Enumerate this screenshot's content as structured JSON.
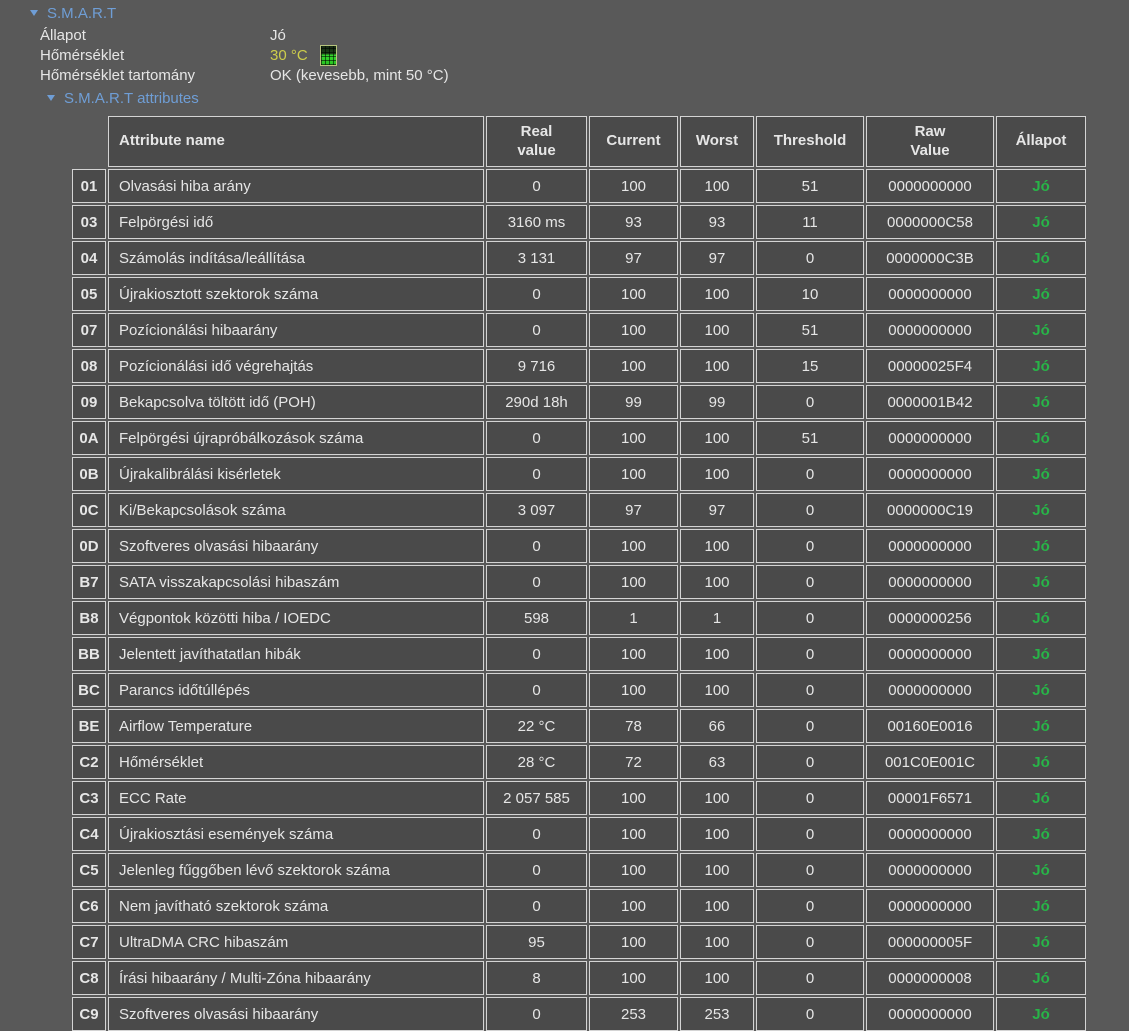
{
  "colors": {
    "page_bg": "#595959",
    "cell_bg": "#4a4a4a",
    "cell_border": "#d4d4d4",
    "section_blue": "#6f9ed6",
    "temperature_yellow": "#cdcd4b",
    "status_green": "#28b448",
    "text": "#e6e6e6"
  },
  "section": {
    "title": "S.M.A.R.T",
    "info": [
      {
        "label": "Állapot",
        "value": "Jó"
      },
      {
        "label": "Hőmérséklet",
        "value": "30 °C",
        "icon": "temperature-gauge-icon"
      },
      {
        "label": "Hőmérséklet tartomány",
        "value": "OK (kevesebb, mint 50 °C)"
      }
    ],
    "subsection_title": "S.M.A.R.T attributes"
  },
  "table": {
    "headers": [
      {
        "label": "Attribute name"
      },
      {
        "label": "Real\nvalue"
      },
      {
        "label": "Current"
      },
      {
        "label": "Worst"
      },
      {
        "label": "Threshold"
      },
      {
        "label": "Raw\nValue"
      },
      {
        "label": "Állapot"
      }
    ],
    "rows": [
      {
        "id": "01",
        "name": "Olvasási hiba arány",
        "real": "0",
        "current": "100",
        "worst": "100",
        "threshold": "51",
        "raw": "0000000000",
        "status": "Jó"
      },
      {
        "id": "03",
        "name": "Felpörgési idő",
        "real": "3160 ms",
        "current": "93",
        "worst": "93",
        "threshold": "11",
        "raw": "0000000C58",
        "status": "Jó"
      },
      {
        "id": "04",
        "name": "Számolás indítása/leállítása",
        "real": "3 131",
        "current": "97",
        "worst": "97",
        "threshold": "0",
        "raw": "0000000C3B",
        "status": "Jó"
      },
      {
        "id": "05",
        "name": "Újrakiosztott szektorok száma",
        "real": "0",
        "current": "100",
        "worst": "100",
        "threshold": "10",
        "raw": "0000000000",
        "status": "Jó"
      },
      {
        "id": "07",
        "name": "Pozícionálási hibaarány",
        "real": "0",
        "current": "100",
        "worst": "100",
        "threshold": "51",
        "raw": "0000000000",
        "status": "Jó"
      },
      {
        "id": "08",
        "name": "Pozícionálási idő végrehajtás",
        "real": "9 716",
        "current": "100",
        "worst": "100",
        "threshold": "15",
        "raw": "00000025F4",
        "status": "Jó"
      },
      {
        "id": "09",
        "name": "Bekapcsolva töltött idő (POH)",
        "real": "290d 18h",
        "current": "99",
        "worst": "99",
        "threshold": "0",
        "raw": "0000001B42",
        "status": "Jó"
      },
      {
        "id": "0A",
        "name": "Felpörgési újrapróbálkozások száma",
        "real": "0",
        "current": "100",
        "worst": "100",
        "threshold": "51",
        "raw": "0000000000",
        "status": "Jó"
      },
      {
        "id": "0B",
        "name": "Újrakalibrálási kisérletek",
        "real": "0",
        "current": "100",
        "worst": "100",
        "threshold": "0",
        "raw": "0000000000",
        "status": "Jó"
      },
      {
        "id": "0C",
        "name": "Ki/Bekapcsolások száma",
        "real": "3 097",
        "current": "97",
        "worst": "97",
        "threshold": "0",
        "raw": "0000000C19",
        "status": "Jó"
      },
      {
        "id": "0D",
        "name": "Szoftveres olvasási hibaarány",
        "real": "0",
        "current": "100",
        "worst": "100",
        "threshold": "0",
        "raw": "0000000000",
        "status": "Jó"
      },
      {
        "id": "B7",
        "name": "SATA visszakapcsolási hibaszám",
        "real": "0",
        "current": "100",
        "worst": "100",
        "threshold": "0",
        "raw": "0000000000",
        "status": "Jó"
      },
      {
        "id": "B8",
        "name": "Végpontok közötti hiba / IOEDC",
        "real": "598",
        "current": "1",
        "worst": "1",
        "threshold": "0",
        "raw": "0000000256",
        "status": "Jó"
      },
      {
        "id": "BB",
        "name": "Jelentett javíthatatlan hibák",
        "real": "0",
        "current": "100",
        "worst": "100",
        "threshold": "0",
        "raw": "0000000000",
        "status": "Jó"
      },
      {
        "id": "BC",
        "name": "Parancs időtúllépés",
        "real": "0",
        "current": "100",
        "worst": "100",
        "threshold": "0",
        "raw": "0000000000",
        "status": "Jó"
      },
      {
        "id": "BE",
        "name": "Airflow Temperature",
        "real": "22 °C",
        "current": "78",
        "worst": "66",
        "threshold": "0",
        "raw": "00160E0016",
        "status": "Jó"
      },
      {
        "id": "C2",
        "name": "Hőmérséklet",
        "real": "28 °C",
        "current": "72",
        "worst": "63",
        "threshold": "0",
        "raw": "001C0E001C",
        "status": "Jó"
      },
      {
        "id": "C3",
        "name": "ECC Rate",
        "real": "2 057 585",
        "current": "100",
        "worst": "100",
        "threshold": "0",
        "raw": "00001F6571",
        "status": "Jó"
      },
      {
        "id": "C4",
        "name": "Újrakiosztási események száma",
        "real": "0",
        "current": "100",
        "worst": "100",
        "threshold": "0",
        "raw": "0000000000",
        "status": "Jó"
      },
      {
        "id": "C5",
        "name": "Jelenleg fűggőben lévő szektorok száma",
        "real": "0",
        "current": "100",
        "worst": "100",
        "threshold": "0",
        "raw": "0000000000",
        "status": "Jó"
      },
      {
        "id": "C6",
        "name": "Nem javítható szektorok száma",
        "real": "0",
        "current": "100",
        "worst": "100",
        "threshold": "0",
        "raw": "0000000000",
        "status": "Jó"
      },
      {
        "id": "C7",
        "name": "UltraDMA CRC hibaszám",
        "real": "95",
        "current": "100",
        "worst": "100",
        "threshold": "0",
        "raw": "000000005F",
        "status": "Jó"
      },
      {
        "id": "C8",
        "name": "Írási hibaarány / Multi-Zóna hibaarány",
        "real": "8",
        "current": "100",
        "worst": "100",
        "threshold": "0",
        "raw": "0000000008",
        "status": "Jó"
      },
      {
        "id": "C9",
        "name": "Szoftveres olvasási hibaarány",
        "real": "0",
        "current": "253",
        "worst": "253",
        "threshold": "0",
        "raw": "0000000000",
        "status": "Jó"
      }
    ]
  }
}
